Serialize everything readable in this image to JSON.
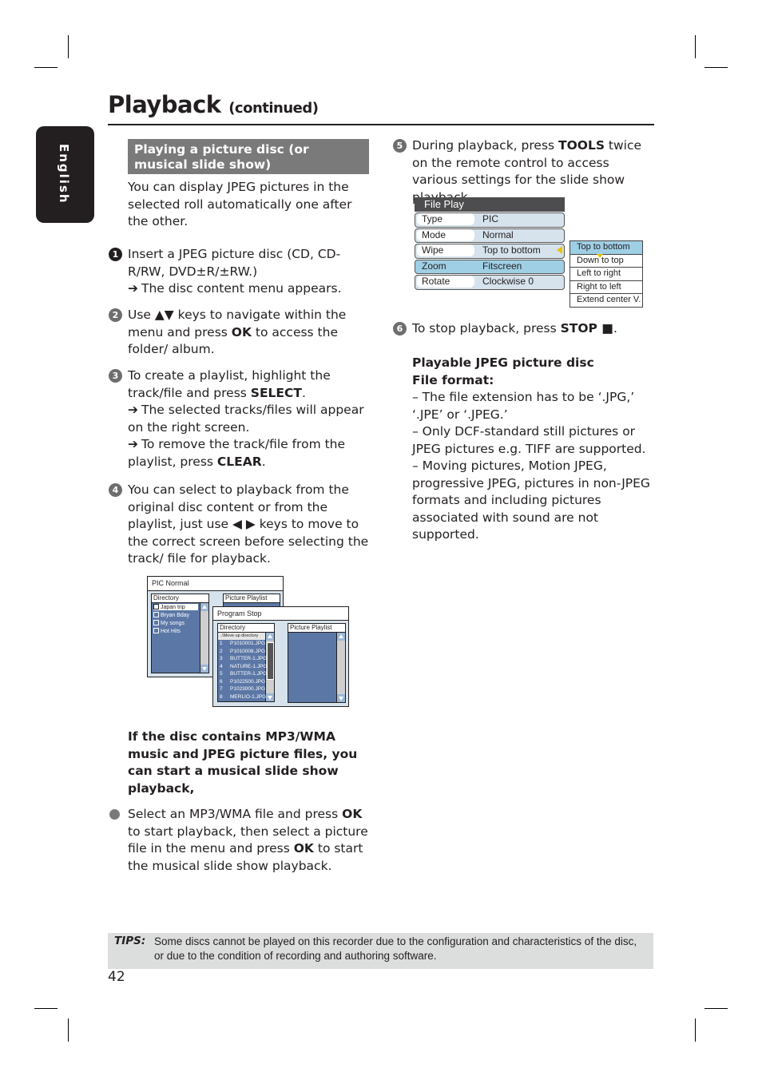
{
  "page": {
    "title": "Playback",
    "title_suffix": "(continued)",
    "language_tab": "English",
    "page_number": "42"
  },
  "left_column": {
    "section_heading": "Playing a picture disc (or musical slide show)",
    "intro": "You can display JPEG pictures in the selected roll automatically one after the other.",
    "steps": [
      {
        "marker": "1",
        "text": "Insert a JPEG picture disc (CD, CD-R/RW, DVD±R/±RW.)",
        "results": [
          "The disc content menu appears."
        ]
      },
      {
        "marker": "2",
        "pre": "Use ▲▼ keys to navigate within the menu and press ",
        "key": "OK",
        "post": " to access the folder/ album."
      },
      {
        "marker": "3",
        "pre": "To create a playlist, highlight the track/file and press ",
        "key": "SELECT",
        "post": ".",
        "results": [
          {
            "text": "The selected tracks/files will appear on the right screen."
          },
          {
            "pre": "To remove the track/file from the playlist, press ",
            "key": "CLEAR",
            "post": "."
          }
        ]
      },
      {
        "marker": "4",
        "text": "You can select to playback from the original disc content or from the playlist, just use ◀ ▶ keys to move to the correct screen before selecting the track/ file for playback."
      }
    ],
    "mp3_note": "If the disc contains MP3/WMA music and JPEG picture files, you can start a musical slide show playback,",
    "bullet": {
      "pre": "Select an MP3/WMA file and press ",
      "key1": "OK",
      "mid": " to start playback, then select a picture file in the menu and press ",
      "key2": "OK",
      "post": " to start the musical slide show playback."
    }
  },
  "screen_back": {
    "title": "PIC Normal",
    "directory_label": "Directory",
    "playlist_label": "Picture Playlist",
    "items": [
      "Japan trip",
      "Bryan Bday",
      "My songs",
      "Hot Hits"
    ]
  },
  "screen_front": {
    "title": "Program Stop",
    "directory_label": "Directory",
    "playlist_label": "Picture Playlist",
    "move_up": "..\\Move up directory",
    "files": [
      {
        "n": "1",
        "name": "P1010001.JPG"
      },
      {
        "n": "2",
        "name": "P1010008.JPG"
      },
      {
        "n": "3",
        "name": "BUTTER-1.JPG"
      },
      {
        "n": "4",
        "name": "NATURE-1.JPG"
      },
      {
        "n": "5",
        "name": "BUTTER-1.JPG"
      },
      {
        "n": "6",
        "name": "P1022500.JPG"
      },
      {
        "n": "7",
        "name": "P1023000.JPG"
      },
      {
        "n": "8",
        "name": "MERLIO-1.JPG"
      }
    ]
  },
  "right_column": {
    "step5": {
      "marker": "5",
      "pre": "During playback, press ",
      "key": "TOOLS",
      "post": " twice on the remote control to access various settings for the slide show playback."
    },
    "file_play_menu": {
      "title": "File Play",
      "rows": [
        {
          "label": "Type",
          "value": "PIC"
        },
        {
          "label": "Mode",
          "value": "Normal"
        },
        {
          "label": "Wipe",
          "value": "Top to bottom"
        },
        {
          "label": "Zoom",
          "value": "Fitscreen"
        },
        {
          "label": "Rotate",
          "value": "Clockwise 0"
        }
      ],
      "wipe_options": [
        "Top to bottom",
        "Down to top",
        "Left to right",
        "Right to left",
        "Extend center V."
      ]
    },
    "step6": {
      "marker": "6",
      "pre": "To stop playback, press ",
      "key": "STOP ■",
      "post": "."
    },
    "format_heading_1": "Playable JPEG picture disc",
    "format_heading_2": "File format:",
    "format_notes": [
      "–  The file extension has to be ‘.JPG,’ ‘.JPE’ or ‘.JPEG.’",
      "–  Only DCF-standard still pictures or JPEG pictures e.g. TIFF are supported.",
      "–  Moving pictures, Motion JPEG, progressive JPEG, pictures in non-JPEG formats and including pictures associated with sound are not supported."
    ]
  },
  "tips": {
    "label": "TIPS:",
    "text": "Some discs cannot be played on this recorder due to the configuration and characteristics of the disc, or due to the condition of recording and authoring software."
  }
}
